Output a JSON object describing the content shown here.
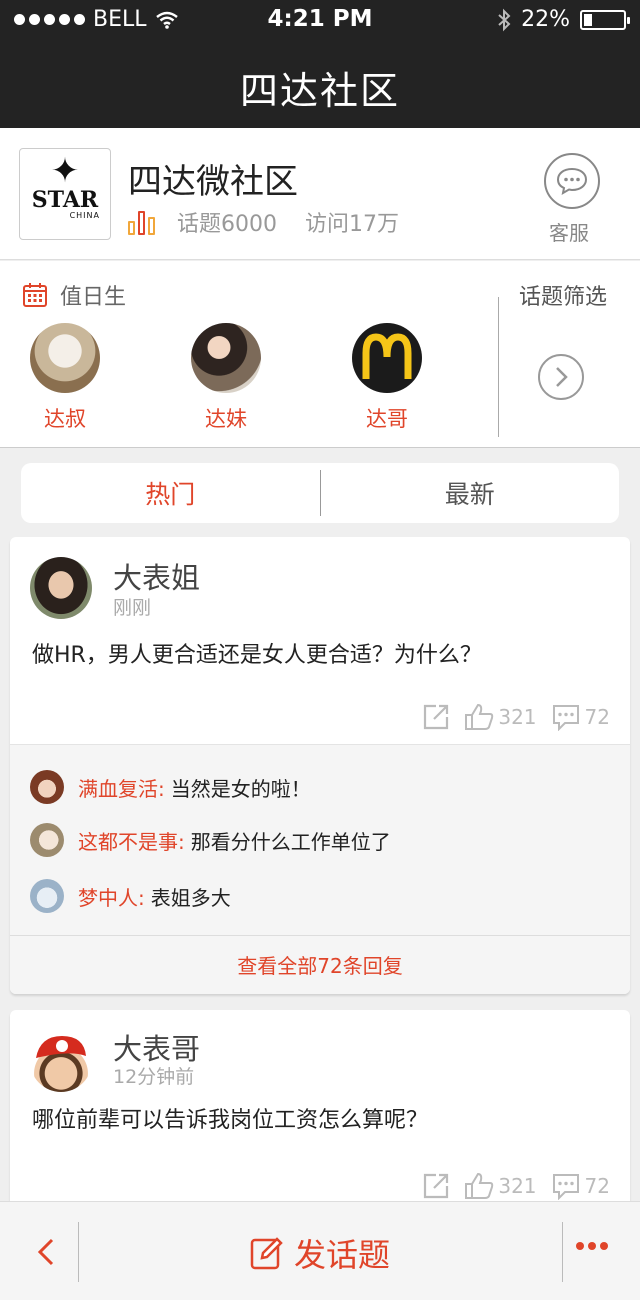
{
  "status_bar": {
    "carrier": "BELL",
    "time": "4:21 PM",
    "battery_text": "22%",
    "battery_level": 0.22,
    "signal_dots": 5
  },
  "nav": {
    "title": "四达社区"
  },
  "community": {
    "logo_text": "STAR",
    "logo_sub": "CHINA",
    "name": "四达微社区",
    "topics": "话题6000",
    "visits": "访问17万",
    "service_label": "客服"
  },
  "duty": {
    "title": "值日生",
    "filter_label": "话题筛选",
    "people": [
      {
        "name": "达叔"
      },
      {
        "name": "达妹"
      },
      {
        "name": "达哥"
      }
    ]
  },
  "tabs": [
    {
      "label": "热门",
      "active": true
    },
    {
      "label": "最新",
      "active": false
    }
  ],
  "posts": [
    {
      "author": "大表姐",
      "time": "刚刚",
      "text": "做HR，男人更合适还是女人更合适？为什么？",
      "likes": "321",
      "comments": "72",
      "replies": [
        {
          "user": "满血复活:",
          "text": "当然是女的啦！"
        },
        {
          "user": "这都不是事:",
          "text": "那看分什么工作单位了"
        },
        {
          "user": "梦中人:",
          "text": "表姐多大"
        }
      ],
      "view_all": "查看全部72条回复"
    },
    {
      "author": "大表哥",
      "time": "12分钟前",
      "text": "哪位前辈可以告诉我岗位工资怎么算呢？",
      "likes": "321",
      "comments": "72"
    }
  ],
  "bottom": {
    "compose_label": "发话题"
  },
  "colors": {
    "accent": "#e0452a",
    "nav_bg": "#232323"
  }
}
